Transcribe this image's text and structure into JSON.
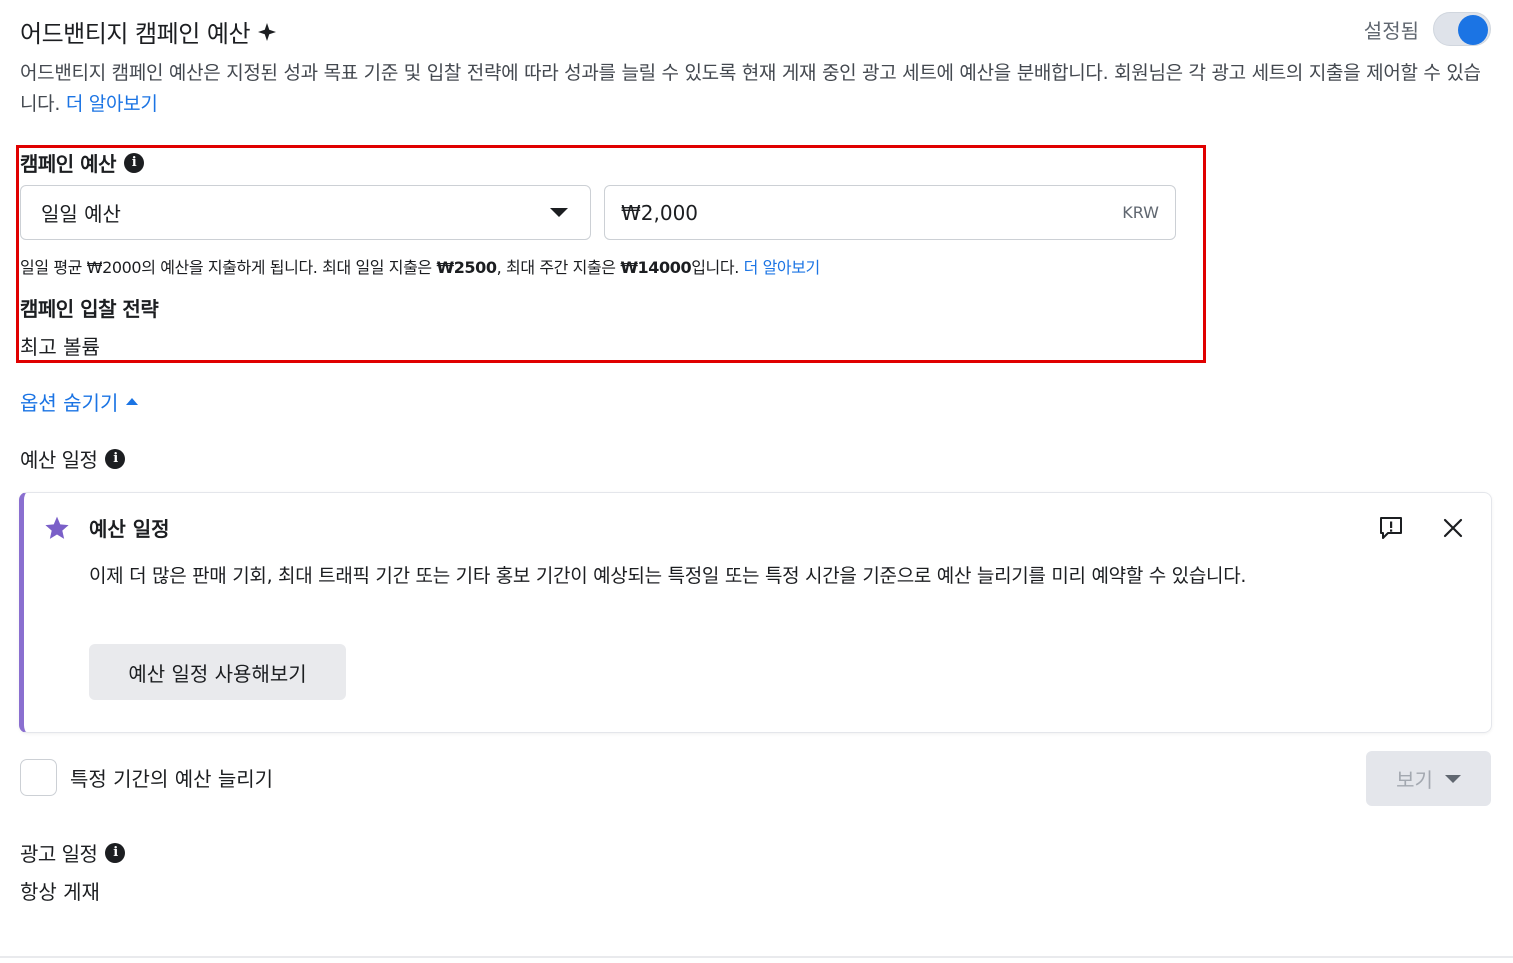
{
  "header": {
    "title": "어드밴티지 캠페인 예산",
    "toggle_label": "설정됨",
    "toggle_on": true,
    "description": "어드밴티지 캠페인 예산은 지정된 성과 목표 기준 및 입찰 전략에 따라 성과를 늘릴 수 있도록 현재 게재 중인 광고 세트에 예산을 분배합니다. 회원님은 각 광고 세트의 지출을 제어할 수 있습니다.",
    "learn_more": "더 알아보기"
  },
  "budget": {
    "label": "캠페인 예산",
    "type_selected": "일일 예산",
    "amount": "₩2,000",
    "currency": "KRW",
    "note_prefix": "일일 평균 ₩2000의 예산을 지출하게 됩니다. 최대 일일 지출은 ",
    "note_daily_max": "₩2500",
    "note_middle": ", 최대 주간 지출은 ",
    "note_weekly_max": "₩14000",
    "note_suffix": "입니다.",
    "note_link": "더 알아보기"
  },
  "bid_strategy": {
    "label": "캠페인 입찰 전략",
    "value": "최고 볼륨"
  },
  "hide_options": "옵션 숨기기",
  "budget_schedule": {
    "label": "예산 일정",
    "card": {
      "title": "예산 일정",
      "body": "이제 더 많은 판매 기회, 최대 트래픽 기간 또는 기타 홍보 기간이 예상되는 특정일 또는 특정 시간을 기준으로 예산 늘리기를 미리 예약할 수 있습니다.",
      "button": "예산 일정 사용해보기",
      "accent_color": "#8a6fd0"
    },
    "checkbox_label": "특정 기간의 예산 늘리기",
    "view_button": "보기"
  },
  "ad_schedule": {
    "label": "광고 일정",
    "value": "항상 게재"
  },
  "colors": {
    "link": "#1b74e4",
    "highlight_box": "#e00000"
  }
}
